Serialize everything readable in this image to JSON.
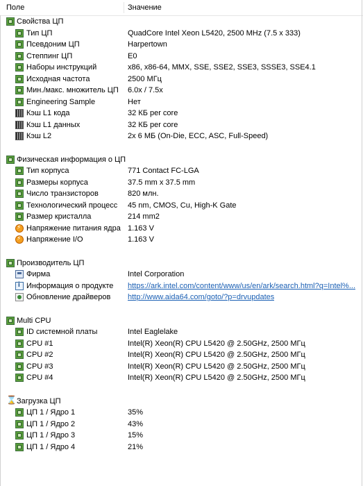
{
  "header": {
    "field": "Поле",
    "value": "Значение"
  },
  "sections": [
    {
      "title": "Свойства ЦП",
      "icon": "cpu-icon",
      "items": [
        {
          "label": "Тип ЦП",
          "value": "QuadCore Intel Xeon L5420, 2500 MHz (7.5 x 333)",
          "icon": "cpu-icon"
        },
        {
          "label": "Псевдоним ЦП",
          "value": "Harpertown",
          "icon": "cpu-icon"
        },
        {
          "label": "Степпинг ЦП",
          "value": "E0",
          "icon": "cpu-icon"
        },
        {
          "label": "Наборы инструкций",
          "value": "x86, x86-64, MMX, SSE, SSE2, SSE3, SSSE3, SSE4.1",
          "icon": "cpu-icon"
        },
        {
          "label": "Исходная частота",
          "value": "2500 МГц",
          "icon": "cpu-icon"
        },
        {
          "label": "Мин./макс. множитель ЦП",
          "value": "6.0x / 7.5x",
          "icon": "cpu-icon"
        },
        {
          "label": "Engineering Sample",
          "value": "Нет",
          "icon": "cpu-icon"
        },
        {
          "label": "Кэш L1 кода",
          "value": "32 КБ per core",
          "icon": "cache-icon"
        },
        {
          "label": "Кэш L1 данных",
          "value": "32 КБ per core",
          "icon": "cache-icon"
        },
        {
          "label": "Кэш L2",
          "value": "2x 6 МБ  (On-Die, ECC, ASC, Full-Speed)",
          "icon": "cache-icon"
        }
      ]
    },
    {
      "title": "Физическая информация о ЦП",
      "icon": "cpu-icon",
      "items": [
        {
          "label": "Тип корпуса",
          "value": "771 Contact FC-LGA",
          "icon": "cpu-icon"
        },
        {
          "label": "Размеры корпуса",
          "value": "37.5 mm x 37.5 mm",
          "icon": "cpu-icon"
        },
        {
          "label": "Число транзисторов",
          "value": "820 млн.",
          "icon": "cpu-icon"
        },
        {
          "label": "Технологический процесс",
          "value": "45 nm, CMOS, Cu, High-K Gate",
          "icon": "cpu-icon"
        },
        {
          "label": "Размер кристалла",
          "value": "214 mm2",
          "icon": "cpu-icon"
        },
        {
          "label": "Напряжение питания ядра",
          "value": "1.163 V",
          "icon": "voltage-icon"
        },
        {
          "label": "Напряжение I/O",
          "value": "1.163 V",
          "icon": "voltage-icon"
        }
      ]
    },
    {
      "title": "Производитель ЦП",
      "icon": "cpu-icon",
      "items": [
        {
          "label": "Фирма",
          "value": "Intel Corporation",
          "icon": "company-icon"
        },
        {
          "label": "Информация о продукте",
          "value": "https://ark.intel.com/content/www/us/en/ark/search.html?q=Intel%...",
          "icon": "info-icon",
          "link": true
        },
        {
          "label": "Обновление драйверов",
          "value": "http://www.aida64.com/goto/?p=drvupdates",
          "icon": "update-icon",
          "link": true
        }
      ]
    },
    {
      "title": "Multi CPU",
      "icon": "cpu-icon",
      "items": [
        {
          "label": "ID системной платы",
          "value": "Intel Eaglelake",
          "icon": "cpu-icon"
        },
        {
          "label": "CPU #1",
          "value": "Intel(R) Xeon(R) CPU L5420 @ 2.50GHz, 2500 МГц",
          "icon": "cpu-icon"
        },
        {
          "label": "CPU #2",
          "value": "Intel(R) Xeon(R) CPU L5420 @ 2.50GHz, 2500 МГц",
          "icon": "cpu-icon"
        },
        {
          "label": "CPU #3",
          "value": "Intel(R) Xeon(R) CPU L5420 @ 2.50GHz, 2500 МГц",
          "icon": "cpu-icon"
        },
        {
          "label": "CPU #4",
          "value": "Intel(R) Xeon(R) CPU L5420 @ 2.50GHz, 2500 МГц",
          "icon": "cpu-icon"
        }
      ]
    },
    {
      "title": "Загрузка ЦП",
      "icon": "hourglass-icon",
      "items": [
        {
          "label": "ЦП 1 / Ядро 1",
          "value": "35%",
          "icon": "cpu-icon"
        },
        {
          "label": "ЦП 1 / Ядро 2",
          "value": "43%",
          "icon": "cpu-icon"
        },
        {
          "label": "ЦП 1 / Ядро 3",
          "value": "15%",
          "icon": "cpu-icon"
        },
        {
          "label": "ЦП 1 / Ядро 4",
          "value": "21%",
          "icon": "cpu-icon"
        }
      ]
    }
  ]
}
